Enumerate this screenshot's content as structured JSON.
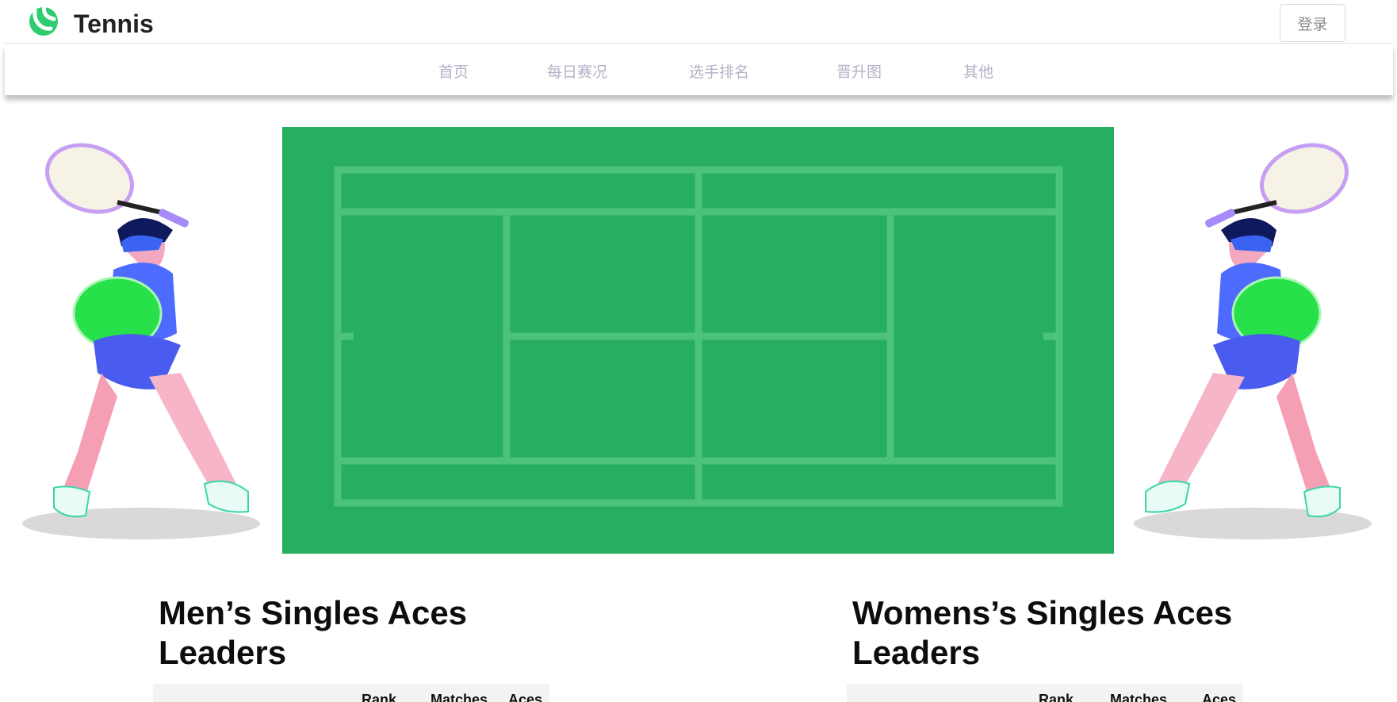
{
  "header": {
    "brand": "Tennis",
    "login_label": "登录"
  },
  "nav": {
    "items": [
      {
        "label": "首页"
      },
      {
        "label": "每日赛况"
      },
      {
        "label": "选手排名"
      },
      {
        "label": "晋升图"
      },
      {
        "label": "其他"
      }
    ]
  },
  "colors": {
    "accent": "#22c55e",
    "court": "#27ae60",
    "court_lines": "#4cc27d"
  },
  "sections": {
    "men": {
      "title": "Men’s Singles Aces Leaders",
      "columns": [
        "Rank",
        "Matches",
        "Aces"
      ]
    },
    "women": {
      "title": "Womens’s Singles Aces Leaders",
      "columns": [
        "Rank",
        "Matches",
        "Aces"
      ]
    }
  }
}
